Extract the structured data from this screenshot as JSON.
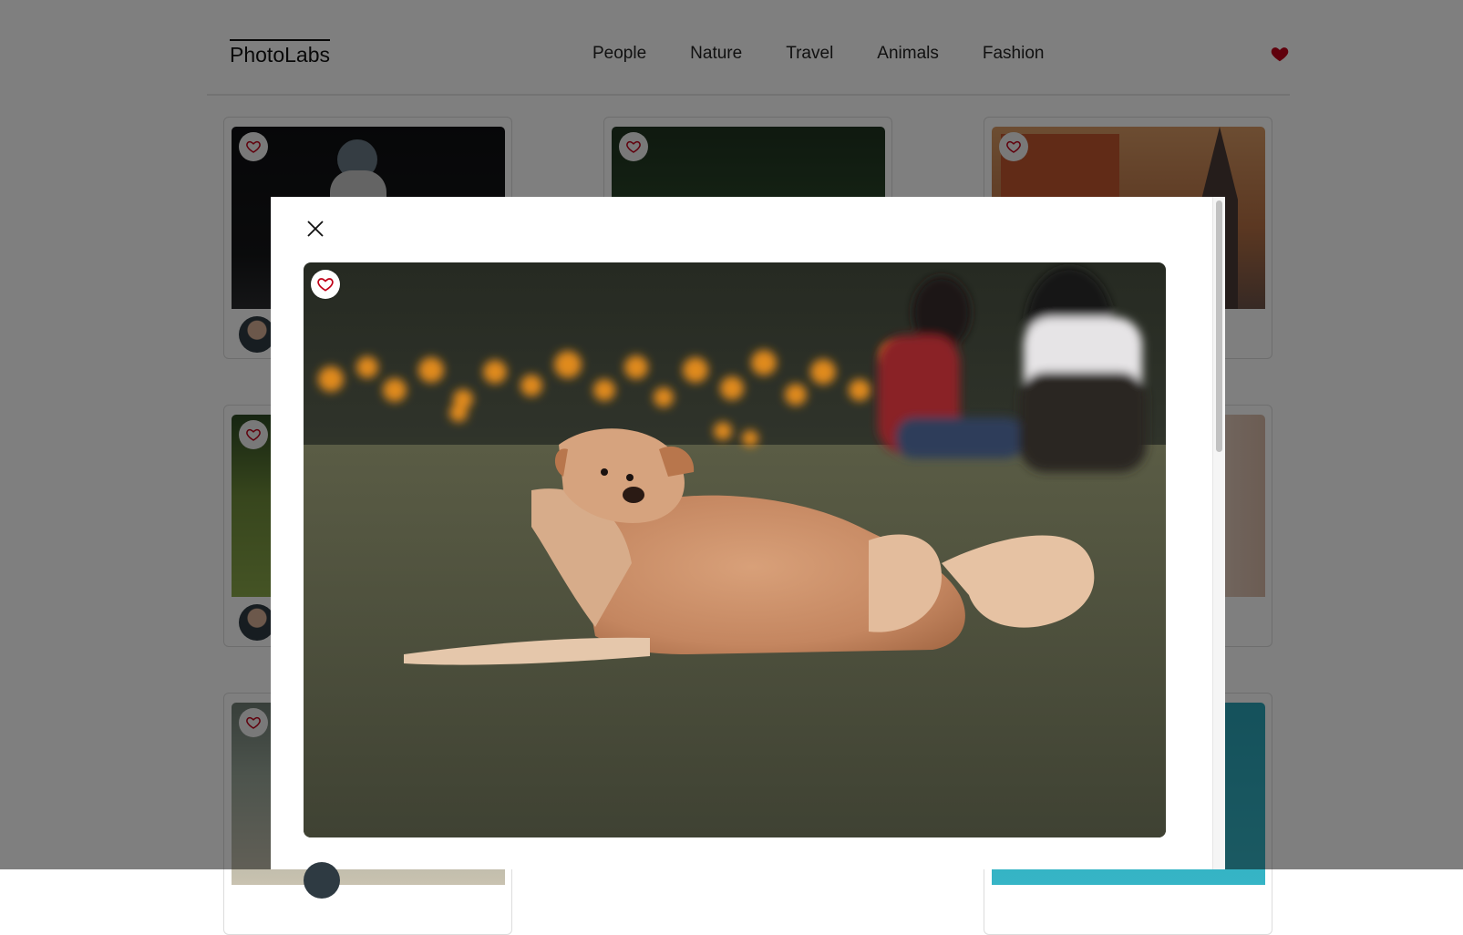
{
  "app": {
    "logo": "PhotoLabs"
  },
  "nav": {
    "topics": [
      "People",
      "Nature",
      "Travel",
      "Animals",
      "Fashion"
    ],
    "fav_icon": "heart-filled-icon",
    "fav_color": "#c00018"
  },
  "grid": {
    "like_icon": "heart-outline-icon"
  },
  "modal": {
    "close_icon": "close-icon",
    "like_icon": "heart-outline-icon",
    "author_name": ""
  },
  "colors": {
    "heart": "#c00018",
    "overlay": "rgba(0,0,0,0.5)"
  }
}
